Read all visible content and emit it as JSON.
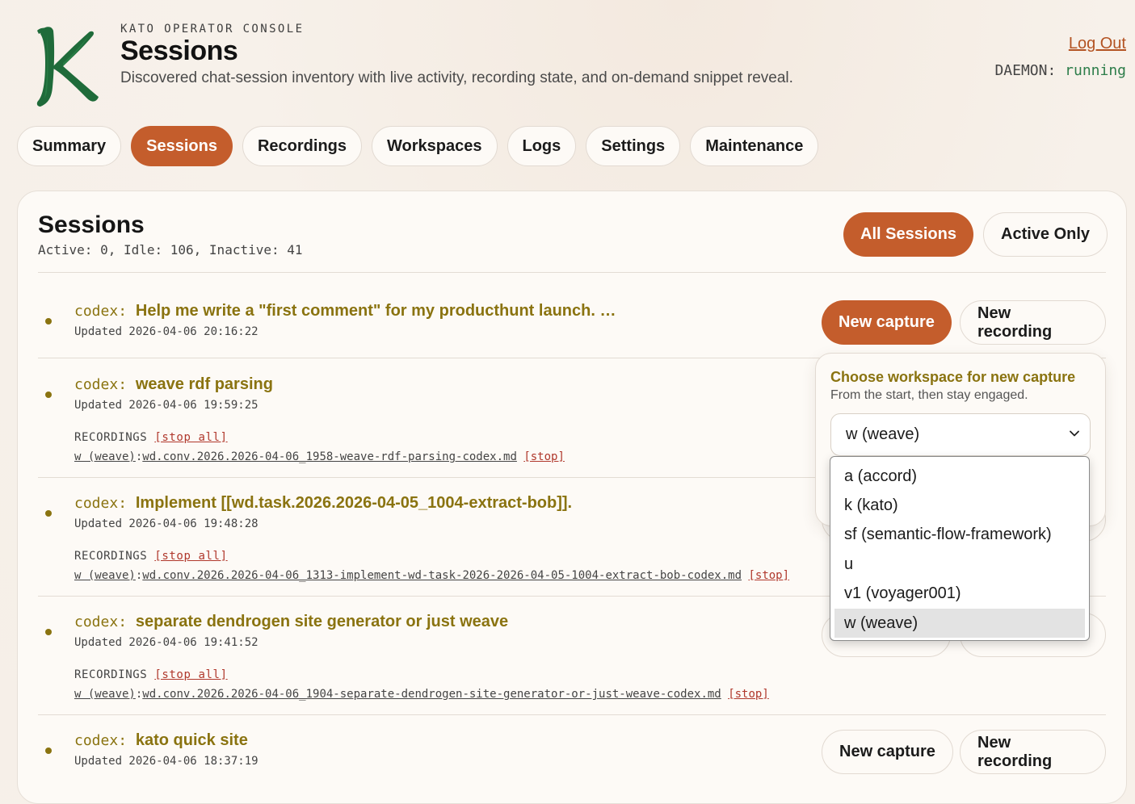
{
  "header": {
    "eyebrow": "KATO OPERATOR CONSOLE",
    "title": "Sessions",
    "description": "Discovered chat-session inventory with live activity, recording state, and on-demand snippet reveal.",
    "logout": "Log Out",
    "daemon_label": "DAEMON:",
    "daemon_status": "running",
    "daemon_status_color": "#2d7d4a",
    "brand_color": "#c45d2c",
    "logo_color": "#1f6b3a"
  },
  "nav": {
    "tabs": [
      "Summary",
      "Sessions",
      "Recordings",
      "Workspaces",
      "Logs",
      "Settings",
      "Maintenance"
    ],
    "active": "Sessions"
  },
  "card": {
    "title": "Sessions",
    "stats": "Active: 0, Idle: 106, Inactive: 41",
    "filters": {
      "all": "All Sessions",
      "active": "Active Only",
      "selected": "All Sessions"
    }
  },
  "labels": {
    "new_capture": "New capture",
    "new_recording": "New recording",
    "recordings": "RECORDINGS",
    "stop_all": "[stop all]",
    "stop": "[stop]"
  },
  "sessions": [
    {
      "agent": "codex",
      "title": "Help me write a \"first comment\" for my producthunt launch. …",
      "updated": "Updated 2026-04-06 20:16:22"
    },
    {
      "agent": "codex",
      "title": "weave rdf parsing",
      "updated": "Updated 2026-04-06 19:59:25",
      "recording": {
        "workspace": "w (weave)",
        "file": "wd.conv.2026.2026-04-06_1958-weave-rdf-parsing-codex.md"
      }
    },
    {
      "agent": "codex",
      "title": "Implement [[wd.task.2026.2026-04-05_1004-extract-bob]].",
      "updated": "Updated 2026-04-06 19:48:28",
      "recording": {
        "workspace": "w (weave)",
        "file": "wd.conv.2026.2026-04-06_1313-implement-wd-task-2026-2026-04-05-1004-extract-bob-codex.md"
      }
    },
    {
      "agent": "codex",
      "title": "separate dendrogen site generator or just weave",
      "updated": "Updated 2026-04-06 19:41:52",
      "recording": {
        "workspace": "w (weave)",
        "file": "wd.conv.2026.2026-04-06_1904-separate-dendrogen-site-generator-or-just-weave-codex.md"
      }
    },
    {
      "agent": "codex",
      "title": "kato quick site",
      "updated": "Updated 2026-04-06 18:37:19"
    }
  ],
  "popover": {
    "title": "Choose workspace for new capture",
    "subtitle": "From the start, then stay engaged.",
    "selected": "w (weave)",
    "options": [
      "a (accord)",
      "k (kato)",
      "sf (semantic-flow-framework)",
      "u",
      "v1 (voyager001)",
      "w (weave)"
    ]
  }
}
